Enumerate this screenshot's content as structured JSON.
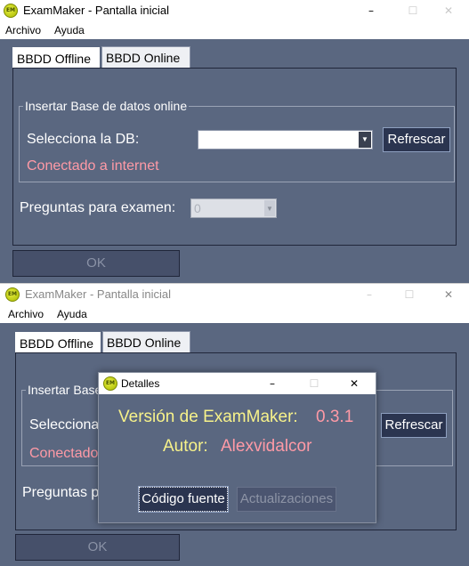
{
  "app": {
    "title": "ExamMaker - Pantalla inicial",
    "icon_text": "EM",
    "menu": [
      "Archivo",
      "Ayuda"
    ],
    "window_controls": {
      "minimize": "–",
      "maximize": "☐",
      "close": "✕"
    }
  },
  "tabs": [
    "BBDD Offline",
    "BBDD Online"
  ],
  "online_group": {
    "title": "Insertar Base de datos online",
    "select_label": "Selecciona la DB:",
    "select_value": "",
    "refresh_button": "Refrescar",
    "status": "Conectado a internet"
  },
  "exam": {
    "questions_label": "Preguntas para examen:",
    "questions_value": "0"
  },
  "ok_button": "OK",
  "window2_partial": {
    "group_title": "Insertar Base",
    "select_label": "Selecciona",
    "status": "Conectado",
    "questions_label": "Preguntas pa"
  },
  "details_dialog": {
    "title": "Detalles",
    "version_label": "Versión de ExamMaker:",
    "version_value": "0.3.1",
    "author_label": "Autor:",
    "author_value": "Alexvidalcor",
    "source_button": "Código fuente",
    "updates_button": "Actualizaciones"
  },
  "colors": {
    "client_bg": "#5a6780",
    "button_bg": "#2b3550",
    "status_pink": "#ff9aa6",
    "dialog_yellow": "#f7f28a"
  }
}
